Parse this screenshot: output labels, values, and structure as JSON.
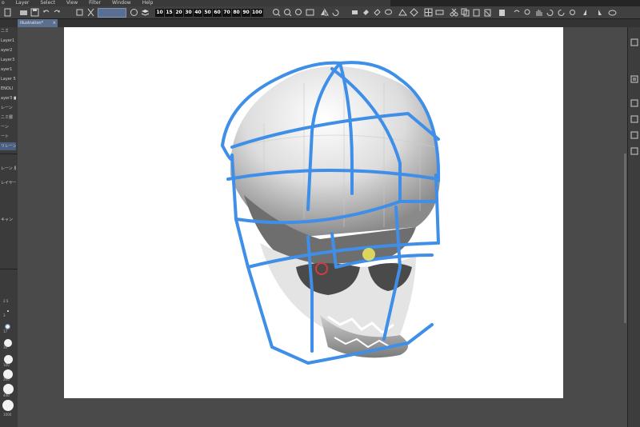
{
  "menu": [
    "o",
    "Layer",
    "Select",
    "View",
    "Filter",
    "Window",
    "Help"
  ],
  "brush_sizes": [
    "10",
    "15",
    "20",
    "30",
    "40",
    "50",
    "60",
    "70",
    "80",
    "90",
    "100"
  ],
  "document_tab": {
    "label": "illustration*",
    "close": "×"
  },
  "left_panel_rows": [
    "ニミ",
    "Layer1",
    "ayer2",
    "Layer3",
    "ayer1",
    "Layer 5",
    "ENOLI",
    "ayer3 ■",
    "レーン",
    "ニミ層",
    "ーン",
    "ート",
    "リレーン",
    "レーン 層",
    "レイヤー",
    "キャン"
  ],
  "brush_size_values": [
    "2.5",
    "3",
    "5",
    "17",
    "30",
    "50",
    "100",
    "200",
    "300",
    "400",
    "600",
    "1000"
  ],
  "icons": {
    "toolbar": [
      "new-file-icon",
      "open-icon",
      "save-icon",
      "undo-icon",
      "redo-icon",
      "transform-icon",
      "zoom-in-icon",
      "zoom-out-icon",
      "zoom-fit-icon",
      "rotate-icon",
      "flip-icon",
      "cut-icon",
      "copy-icon",
      "paste-icon",
      "clear-icon"
    ],
    "right_strip": [
      "layer-icon",
      "property-icon",
      "history-icon",
      "material-icon",
      "navigator-icon",
      "sub-view-icon"
    ]
  },
  "colors": {
    "workspace": "#4a4a4a",
    "canvas": "#ffffff",
    "guide_lines": "#3f8ee8",
    "active_tab": "#5d6f8f"
  }
}
